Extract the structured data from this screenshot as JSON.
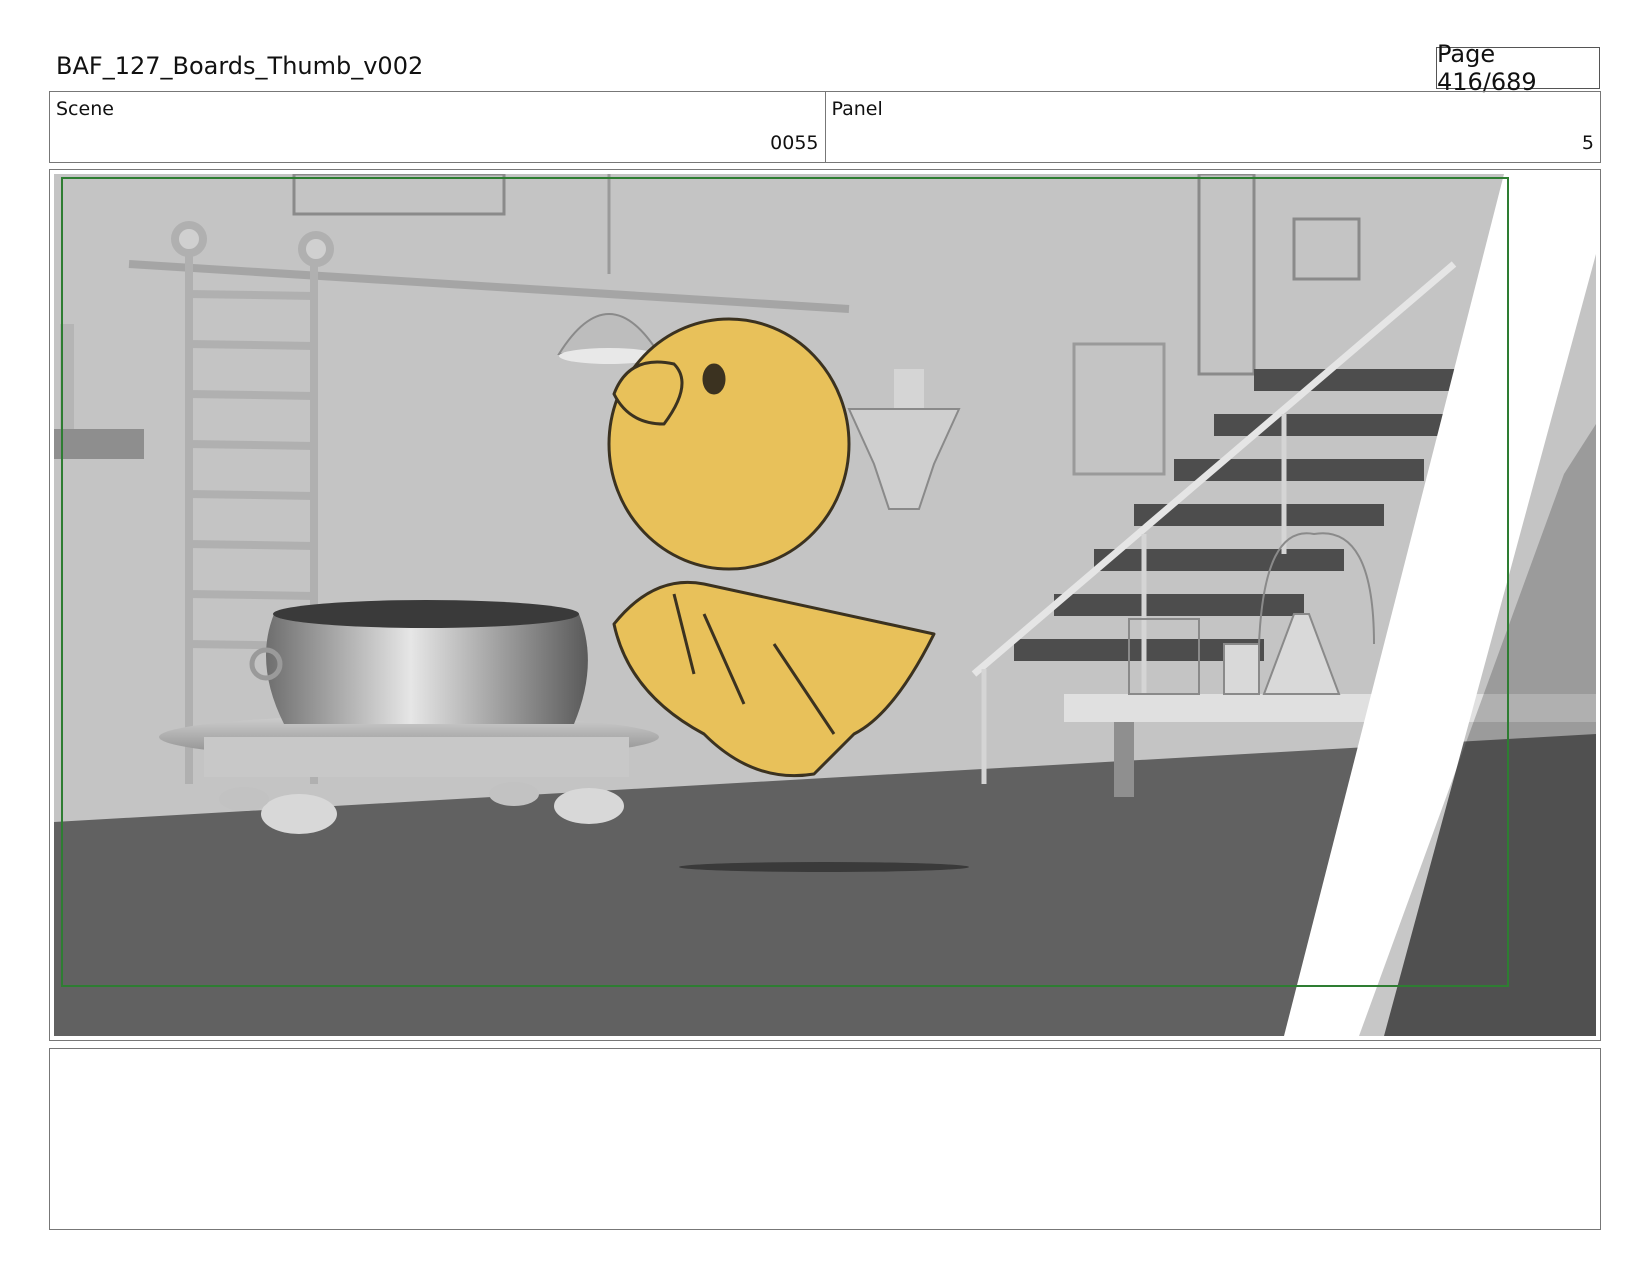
{
  "header": {
    "title": "BAF_127_Boards_Thumb_v002",
    "page": "Page 416/689"
  },
  "info": {
    "scene_label": "Scene",
    "scene_value": "0055",
    "panel_label": "Panel",
    "panel_value": "5"
  },
  "colors": {
    "safe_frame": "#2e7d32",
    "character_fill": "#e8c15a",
    "floor": "#616161",
    "wall": "#c4c4c4"
  }
}
